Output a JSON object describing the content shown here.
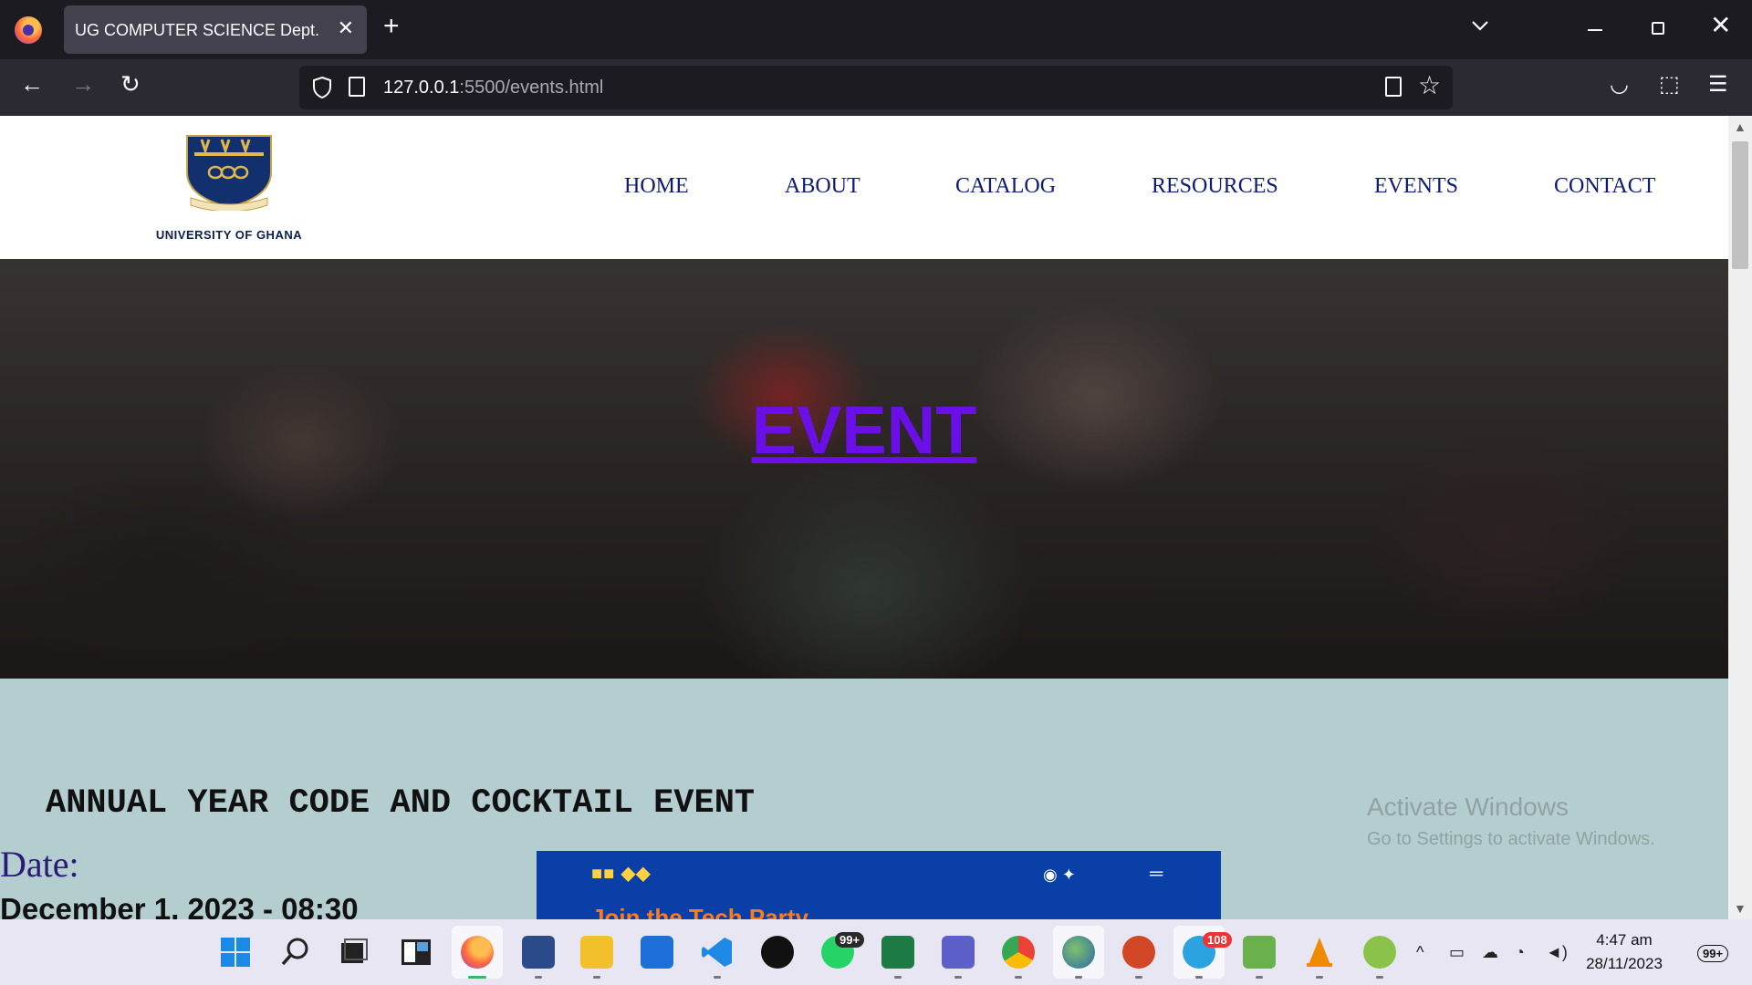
{
  "browser": {
    "tab_title": "UG COMPUTER SCIENCE Dept.",
    "url_host": "127.0.0.1",
    "url_rest": ":5500/events.html"
  },
  "site": {
    "logo_text": "UNIVERSITY OF GHANA",
    "logo_motto": "INTEGRI PROCEDAMUS",
    "nav": [
      "HOME",
      "ABOUT",
      "CATALOG",
      "RESOURCES",
      "EVENTS",
      "CONTACT"
    ],
    "hero_title": "EVENT",
    "event_title": "ANNUAL YEAR CODE AND COCKTAIL EVENT",
    "date_label": "Date:",
    "date_value": "December 1, 2023 - 08:30",
    "poster_text": "Join the Tech Party"
  },
  "watermark": {
    "title": "Activate Windows",
    "subtitle": "Go to Settings to activate Windows."
  },
  "taskbar": {
    "whatsapp_badge": "99+",
    "telegram_badge": "108",
    "time": "4:47 am",
    "date": "28/11/2023",
    "notif_badge": "99+"
  },
  "colors": {
    "hero_title": "#6a0fe8",
    "nav_link": "#0d1a7a",
    "content_bg": "#b4ced0"
  }
}
